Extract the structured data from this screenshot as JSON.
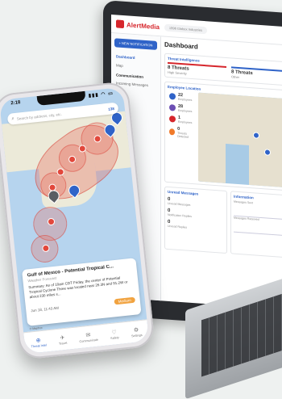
{
  "laptop": {
    "brand": "AlertMedia",
    "company": "1996 Globex Industries",
    "sidebar": {
      "new_button": "+ NEW NOTIFICATION",
      "items": [
        "Dashboard",
        "Map"
      ],
      "section": "Communication",
      "section_items": [
        "Incoming Messages"
      ]
    },
    "page_title": "Dashboard",
    "threat_card": {
      "title": "Threat Intelligence",
      "threats": [
        {
          "count": "8 Threats",
          "label": "High Severity"
        },
        {
          "count": "8 Threats",
          "label": "Other"
        }
      ]
    },
    "map_card": {
      "title": "Employee Location",
      "stats": [
        {
          "value": "22",
          "label": "Employees",
          "color": "#2f63c8"
        },
        {
          "value": "28",
          "label": "Employees",
          "color": "#6c4fb4"
        },
        {
          "value": "1",
          "label": "Employees",
          "color": "#d6262c"
        },
        {
          "value": "0",
          "label": "Threats Detected",
          "color": "#f07a2a"
        }
      ]
    },
    "unread_card": {
      "title": "Unread Messages",
      "metrics": [
        {
          "value": "0",
          "label": "Unread Messages"
        },
        {
          "value": "0",
          "label": "Notification Replies"
        },
        {
          "value": "0",
          "label": "Unread Replies"
        }
      ]
    },
    "info_card": {
      "title": "Information",
      "rows": [
        "Messages Sent",
        "Messages Received"
      ]
    }
  },
  "phone": {
    "time": "2:18",
    "status_icons": "▮▮▮ ◠ ▭",
    "search_placeholder": "Search by address, city, etc.",
    "result_count": "138",
    "alert": {
      "title": "Gulf of Mexico - Potential Tropical C...",
      "subtitle": "Weather Forecast",
      "body": "Summary: As of 10am CDT Friday, the center of Potential Tropical Cyclone Three was located near 26.3N and 91.2W or about 230 miles s...",
      "time": "Jun 18, 11:43 AM",
      "severity": "Medium",
      "severity_color": "#f1a340"
    },
    "map_attribution": "© Mapbox",
    "tabs": [
      {
        "label": "Threat Intel",
        "icon": "⊕",
        "active": true
      },
      {
        "label": "Travel",
        "icon": "✈",
        "active": false
      },
      {
        "label": "Communicate",
        "icon": "✉",
        "active": false
      },
      {
        "label": "Safety",
        "icon": "♡",
        "active": false
      },
      {
        "label": "Settings",
        "icon": "⚙",
        "active": false
      }
    ]
  }
}
